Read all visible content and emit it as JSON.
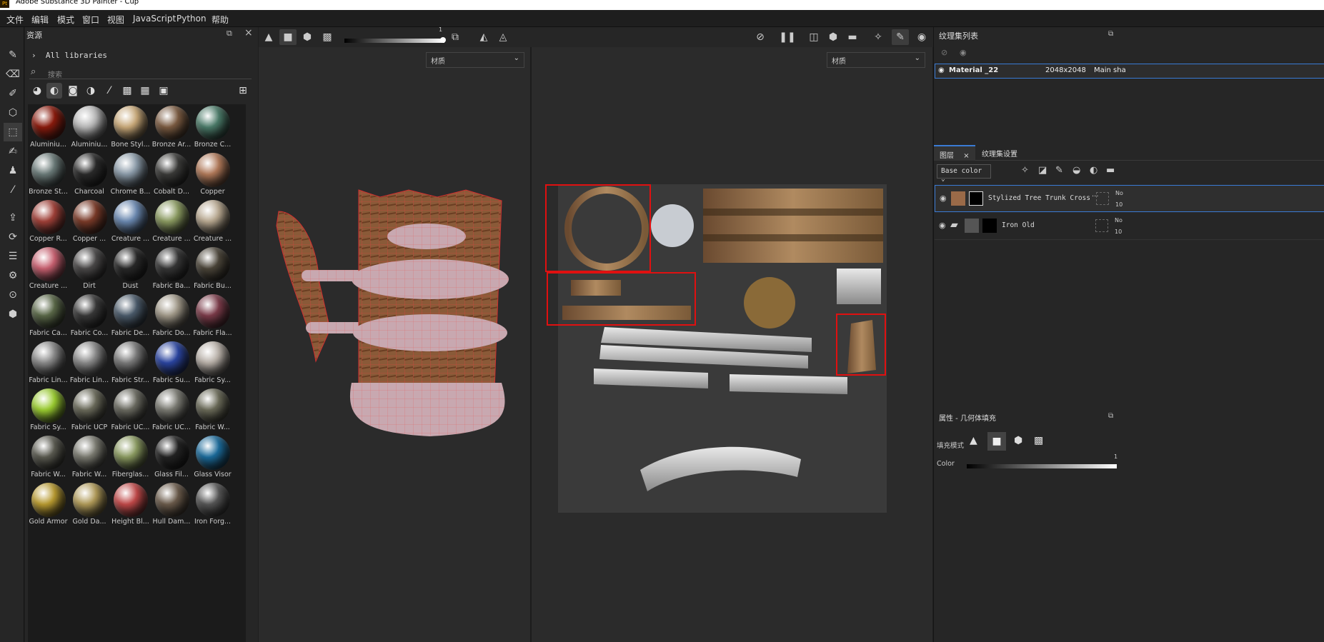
{
  "window": {
    "title": "Adobe Substance 3D Painter - Cup",
    "app_badge": "Pt",
    "minimize": "—"
  },
  "menu": [
    "文件",
    "编辑",
    "模式",
    "窗口",
    "视图",
    "JavaScript",
    "Python",
    "帮助"
  ],
  "left_tools": [
    "paint-brush",
    "eraser",
    "projection",
    "polygon-fill",
    "geometry-mask",
    "smudge",
    "clone",
    "color-picker",
    "export",
    "bake",
    "history",
    "settings",
    "screenshot",
    "viewer-settings"
  ],
  "assets": {
    "title": "资源",
    "library": "All libraries",
    "search_placeholder": "搜索",
    "materials": [
      "Aluminiu...",
      "Aluminiu...",
      "Bone Styl...",
      "Bronze Ar...",
      "Bronze C...",
      "Bronze St...",
      "Charcoal",
      "Chrome B...",
      "Cobalt D...",
      "Copper",
      "Copper R...",
      "Copper ...",
      "Creature ...",
      "Creature ...",
      "Creature ...",
      "Creature ...",
      "Dirt",
      "Dust",
      "Fabric Ba...",
      "Fabric Bu...",
      "Fabric Ca...",
      "Fabric Co...",
      "Fabric De...",
      "Fabric Do...",
      "Fabric Fla...",
      "Fabric Lin...",
      "Fabric Lin...",
      "Fabric Str...",
      "Fabric Su...",
      "Fabric Sy...",
      "Fabric Sy...",
      "Fabric UCP",
      "Fabric UC...",
      "Fabric UC...",
      "Fabric W...",
      "Fabric W...",
      "Fabric W...",
      "Fiberglas...",
      "Glass Fil...",
      "Glass Visor",
      "Gold Armor",
      "Gold Da...",
      "Height Bl...",
      "Hull Dam...",
      "Iron Forg..."
    ],
    "colors": [
      "#8a1a0c",
      "#b8b8b8",
      "#c8a878",
      "#7a5a40",
      "#4a7a68",
      "#6a7a78",
      "#2a2a2a",
      "#8a9aa8",
      "#3a3a38",
      "#b07858",
      "#a04038",
      "#7a3a28",
      "#6a88b0",
      "#8a9a60",
      "#b8a890",
      "#c86070",
      "#4a4848",
      "#282828",
      "#353535",
      "#4a4438",
      "#5a6848",
      "#383838",
      "#4a5a6a",
      "#a09888",
      "#7a3a48",
      "#8a8a8a",
      "#8a8a8a",
      "#7a7a7a",
      "#2a44a0",
      "#b8b0a8",
      "#9acc30",
      "#6a6a5a",
      "#6a6a60",
      "#7a7a72",
      "#6a6a58",
      "#5a5a50",
      "#7a7a70",
      "#8a9a60",
      "#222222",
      "#1a6a9a",
      "#b89a30",
      "#b09a58",
      "#c04848",
      "#6a5a4a",
      "#555555"
    ]
  },
  "viewport": {
    "slider_value": "1",
    "dropdown_3d": "材质",
    "dropdown_2d": "材质"
  },
  "texture_sets": {
    "title": "纹理集列表",
    "rows": [
      {
        "name": "Material _22",
        "size": "2048x2048",
        "shader": "Main sha"
      }
    ]
  },
  "layers": {
    "tab_layers": "图层",
    "tab_settings": "纹理集设置",
    "channel": "Base color",
    "items": [
      {
        "name": "Stylized Tree Trunk Cross",
        "dots": "···",
        "n1": "No",
        "n2": "10"
      },
      {
        "name": "Iron Old",
        "n1": "No",
        "n2": "10"
      }
    ]
  },
  "properties": {
    "title": "属性 - 几何体填充",
    "fill_mode_label": "填充模式",
    "color_label": "Color",
    "color_value": "1"
  }
}
